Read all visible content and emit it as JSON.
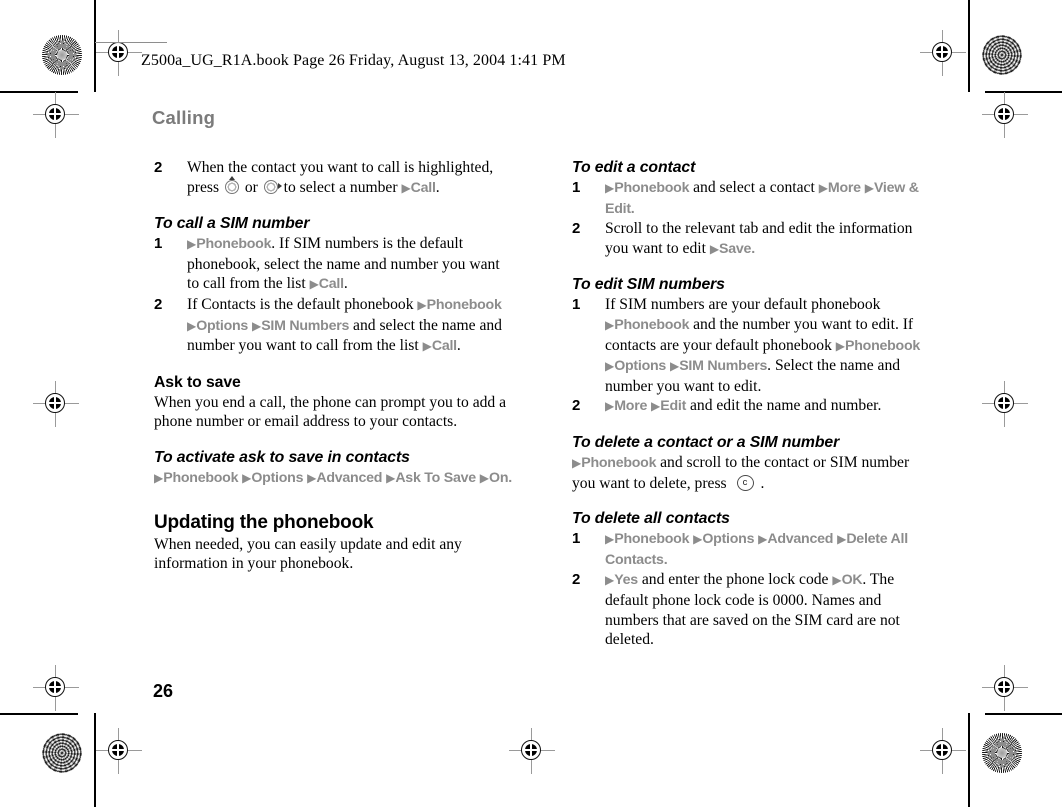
{
  "page": {
    "file_header": "Z500a_UG_R1A.book  Page 26  Friday, August 13, 2004  1:41 PM",
    "running_head": "Calling",
    "folio": "26",
    "colors": {
      "menu_gray": "#8c8c8c",
      "running_head_gray": "#7b7b7b",
      "body_black": "#000000"
    }
  },
  "left_column": {
    "step2_call_contact": {
      "num": "2",
      "t1": "When the contact you want to call is highlighted, press ",
      "t2": " or ",
      "t3": " to select a number",
      "menu_call": "Call",
      "period": "."
    },
    "to_call_sim_number": {
      "heading": "To call a SIM number",
      "step1": {
        "num": "1",
        "menu_phonebook": "Phonebook",
        "t1": ". If SIM numbers is the default phonebook, select the name and number you want to call from the list ",
        "menu_call": "Call",
        "period": "."
      },
      "step2": {
        "num": "2",
        "t1": "If Contacts is the default phonebook ",
        "menu_phonebook": "Phonebook",
        "menu_options": "Options",
        "menu_sim_numbers": "SIM Numbers",
        "t2": " and select the name and number you want to call from the list ",
        "menu_call": "Call",
        "period": "."
      }
    },
    "ask_to_save": {
      "heading": "Ask to save",
      "body": "When you end a call, the phone can prompt you to add a phone number or email address to your contacts."
    },
    "to_activate_ask_to_save": {
      "heading": "To activate ask to save in contacts",
      "menu_phonebook": "Phonebook",
      "menu_options": "Options",
      "menu_advanced": "Advanced",
      "menu_ask_to_save": "Ask To Save",
      "menu_on": "On",
      "period": "."
    },
    "updating_the_phonebook": {
      "heading": "Updating the phonebook",
      "body": "When needed, you can easily update and edit any information in your phonebook."
    }
  },
  "right_column": {
    "to_edit_a_contact": {
      "heading": "To edit a contact",
      "step1": {
        "num": "1",
        "menu_phonebook": "Phonebook",
        "t1": " and select a contact ",
        "menu_more": "More",
        "menu_view_edit": "View & Edit",
        "period": "."
      },
      "step2": {
        "num": "2",
        "t1": "Scroll to the relevant tab and edit the information you want to edit ",
        "menu_save": "Save",
        "period": "."
      }
    },
    "to_edit_sim_numbers": {
      "heading": "To edit SIM numbers",
      "step1": {
        "num": "1",
        "t1": "If SIM numbers are your default phonebook ",
        "menu_phonebook_1": "Phonebook",
        "t2": " and the number you want to edit. If contacts are your default phonebook ",
        "menu_phonebook_2": "Phonebook",
        "menu_options": "Options",
        "menu_sim_numbers": "SIM Numbers",
        "t3": ". Select the name and number you want to edit."
      },
      "step2": {
        "num": "2",
        "menu_more": "More",
        "menu_edit": "Edit",
        "t1": " and edit the name and number."
      }
    },
    "to_delete_contact_or_sim": {
      "heading": "To delete a contact or a SIM number",
      "menu_phonebook": "Phonebook",
      "t1": " and scroll to the contact or SIM number you want to delete, press ",
      "key_label": "c",
      "t2": "."
    },
    "to_delete_all_contacts": {
      "heading": " To delete all contacts",
      "step1": {
        "num": "1",
        "menu_phonebook": "Phonebook",
        "menu_options": "Options",
        "menu_advanced": "Advanced",
        "menu_delete_all_contacts": "Delete All Contacts",
        "period": "."
      },
      "step2": {
        "num": "2",
        "menu_yes": "Yes",
        "t1": " and enter the phone lock code ",
        "menu_ok": "OK",
        "t2": ". The default phone lock code is 0000. Names and numbers that are saved on the SIM card are not deleted."
      }
    }
  },
  "icons": {
    "nav_key_up": "navigation-key-up-icon",
    "nav_key_right": "navigation-key-right-icon",
    "clear_key": "clear-key-icon",
    "arrow": "▶"
  }
}
